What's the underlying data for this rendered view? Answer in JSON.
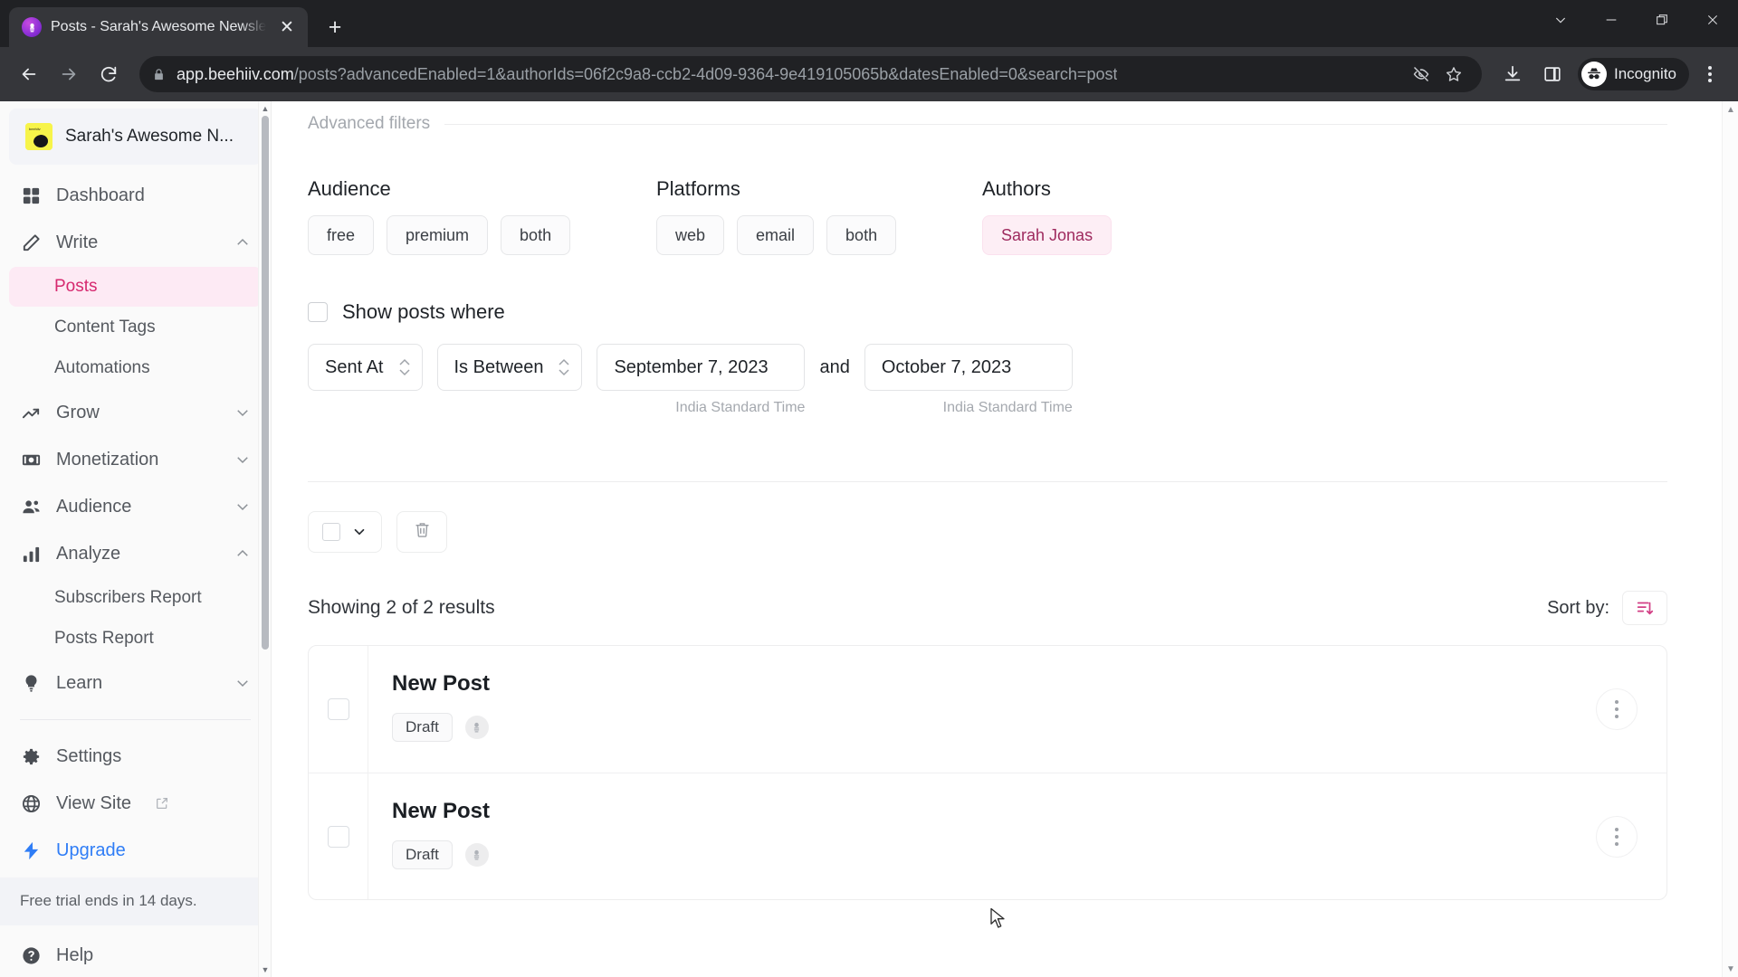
{
  "browser": {
    "tab": {
      "title": "Posts - Sarah's Awesome Newsle",
      "favicon": "beehiiv-icon",
      "close_label": "✕"
    },
    "new_tab_label": "+",
    "window_controls": [
      "chevron-down-icon",
      "minimize-icon",
      "restore-icon",
      "close-icon"
    ],
    "nav": {
      "back": "back-arrow-icon",
      "forward": "forward-arrow-icon",
      "reload": "reload-icon"
    },
    "address": {
      "lock": "lock-icon",
      "domain": "app.beehiiv.com",
      "path": "/posts?advancedEnabled=1&authorIds=06f2c9a8-ccb2-4d09-9364-9e419105065b&datesEnabled=0&search=post",
      "tracking_icon": "eye-crossed-icon",
      "bookmark_icon": "star-icon"
    },
    "toolbar_icons": [
      "download-icon",
      "side-panel-icon"
    ],
    "profile": {
      "label": "Incognito",
      "icon": "incognito-icon"
    },
    "menu_icon": "kebab-menu-icon"
  },
  "sidebar": {
    "brand": {
      "name": "Sarah's Awesome N...",
      "logo": "beehiiv-logo"
    },
    "nav": [
      {
        "label": "Dashboard",
        "icon": "grid-icon",
        "caret": null,
        "active": false
      },
      {
        "label": "Write",
        "icon": "pencil-icon",
        "caret": "chevron-up-icon",
        "active": false
      },
      {
        "label": "Grow",
        "icon": "trending-up-icon",
        "caret": "chevron-down-icon",
        "active": false
      },
      {
        "label": "Monetization",
        "icon": "money-icon",
        "caret": "chevron-down-icon",
        "active": false
      },
      {
        "label": "Audience",
        "icon": "people-icon",
        "caret": "chevron-down-icon",
        "active": false
      },
      {
        "label": "Analyze",
        "icon": "bar-chart-icon",
        "caret": "chevron-up-icon",
        "active": false
      },
      {
        "label": "Learn",
        "icon": "lightbulb-icon",
        "caret": "chevron-down-icon",
        "active": false
      }
    ],
    "write_children": [
      {
        "label": "Posts",
        "active": true
      },
      {
        "label": "Content Tags",
        "active": false
      },
      {
        "label": "Automations",
        "active": false
      }
    ],
    "analyze_children": [
      {
        "label": "Subscribers Report",
        "active": false
      },
      {
        "label": "Posts Report",
        "active": false
      }
    ],
    "footer": [
      {
        "label": "Settings",
        "icon": "gear-icon",
        "external": false,
        "style": "default"
      },
      {
        "label": "View Site",
        "icon": "globe-icon",
        "external": true,
        "style": "default"
      },
      {
        "label": "Upgrade",
        "icon": "bolt-icon",
        "external": false,
        "style": "blue"
      }
    ],
    "trial_notice": "Free trial ends in 14 days.",
    "help": {
      "label": "Help",
      "icon": "question-circle-icon"
    }
  },
  "filters": {
    "section_label": "Advanced filters",
    "audience": {
      "title": "Audience",
      "options": [
        "free",
        "premium",
        "both"
      ]
    },
    "platforms": {
      "title": "Platforms",
      "options": [
        "web",
        "email",
        "both"
      ]
    },
    "authors": {
      "title": "Authors",
      "selected": [
        "Sarah Jonas"
      ]
    },
    "show_posts_where": {
      "label": "Show posts where",
      "checked": false,
      "field": "Sent At",
      "operator": "Is Between",
      "start_date": "September 7, 2023",
      "and_label": "and",
      "end_date": "October 7, 2023",
      "start_timezone": "India Standard Time",
      "end_timezone": "India Standard Time"
    }
  },
  "bulk_bar": {
    "select_all_checked": false,
    "dropdown_icon": "chevron-down-icon",
    "delete_icon": "trash-icon"
  },
  "results": {
    "count_text": "Showing 2 of 2 results",
    "sort_label": "Sort by:",
    "sort_icon": "sort-descending-icon",
    "sort_accent": "#d23f85",
    "posts": [
      {
        "title": "New Post",
        "status": "Draft",
        "avatar": "author-avatar",
        "menu": "more-options-icon",
        "checked": false
      },
      {
        "title": "New Post",
        "status": "Draft",
        "avatar": "author-avatar",
        "menu": "more-options-icon",
        "checked": false
      }
    ]
  },
  "theme": {
    "accent_pink": "#d6296f",
    "accent_blue": "#2f7df6",
    "chrome_dark": "#35363a"
  }
}
